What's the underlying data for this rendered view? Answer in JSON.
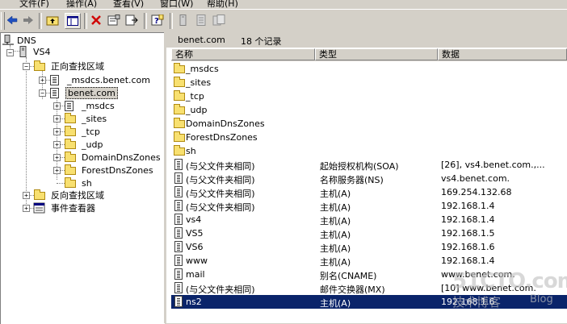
{
  "menu": [
    "文件(F)",
    "操作(A)",
    "查看(V)",
    "窗口(W)",
    "帮助(H)"
  ],
  "toolbar": {
    "icons": [
      "back-arrow-icon",
      "forward-arrow-icon",
      "up-folder-icon",
      "show-tree-icon",
      "delete-icon",
      "properties-icon",
      "export-icon",
      "help-icon",
      "server-icon",
      "document-icon",
      "zone-icon"
    ]
  },
  "tree": {
    "root": "DNS",
    "server": "VS4",
    "forward_zones": "正向查找区域",
    "msdcs_zone": "_msdcs.benet.com",
    "benet_zone": "benet.com",
    "children": [
      "_msdcs",
      "_sites",
      "_tcp",
      "_udp",
      "DomainDnsZones",
      "ForestDnsZones",
      "sh"
    ],
    "reverse_zones": "反向查找区域",
    "event_viewer": "事件查看器"
  },
  "right": {
    "title": "benet.com",
    "count": "18 个记录",
    "columns": [
      "名称",
      "类型",
      "数据"
    ],
    "rows": [
      {
        "name": "_msdcs",
        "type": "",
        "data": "",
        "kind": "folder"
      },
      {
        "name": "_sites",
        "type": "",
        "data": "",
        "kind": "folder"
      },
      {
        "name": "_tcp",
        "type": "",
        "data": "",
        "kind": "folder"
      },
      {
        "name": "_udp",
        "type": "",
        "data": "",
        "kind": "folder"
      },
      {
        "name": "DomainDnsZones",
        "type": "",
        "data": "",
        "kind": "folder"
      },
      {
        "name": "ForestDnsZones",
        "type": "",
        "data": "",
        "kind": "folder"
      },
      {
        "name": "sh",
        "type": "",
        "data": "",
        "kind": "folder"
      },
      {
        "name": "(与父文件夹相同)",
        "type": "起始授权机构(SOA)",
        "data": "[26], vs4.benet.com.,...",
        "kind": "record"
      },
      {
        "name": "(与父文件夹相同)",
        "type": "名称服务器(NS)",
        "data": "vs4.benet.com.",
        "kind": "record"
      },
      {
        "name": "(与父文件夹相同)",
        "type": "主机(A)",
        "data": "169.254.132.68",
        "kind": "record"
      },
      {
        "name": "(与父文件夹相同)",
        "type": "主机(A)",
        "data": "192.168.1.4",
        "kind": "record"
      },
      {
        "name": "vs4",
        "type": "主机(A)",
        "data": "192.168.1.4",
        "kind": "record"
      },
      {
        "name": "VS5",
        "type": "主机(A)",
        "data": "192.168.1.5",
        "kind": "record"
      },
      {
        "name": "VS6",
        "type": "主机(A)",
        "data": "192.168.1.6",
        "kind": "record"
      },
      {
        "name": "www",
        "type": "主机(A)",
        "data": "192.168.1.4",
        "kind": "record"
      },
      {
        "name": "mail",
        "type": "别名(CNAME)",
        "data": "www.benet.com.",
        "kind": "record"
      },
      {
        "name": "(与父文件夹相同)",
        "type": "邮件交换器(MX)",
        "data": "[10]  www.benet.com.",
        "kind": "record"
      },
      {
        "name": "ns2",
        "type": "主机(A)",
        "data": "192.168.1.6",
        "kind": "record"
      }
    ],
    "selected_index": 17
  },
  "watermark": {
    "site": "51CTO.com",
    "caption": "技术博客",
    "blog": "Blog"
  }
}
